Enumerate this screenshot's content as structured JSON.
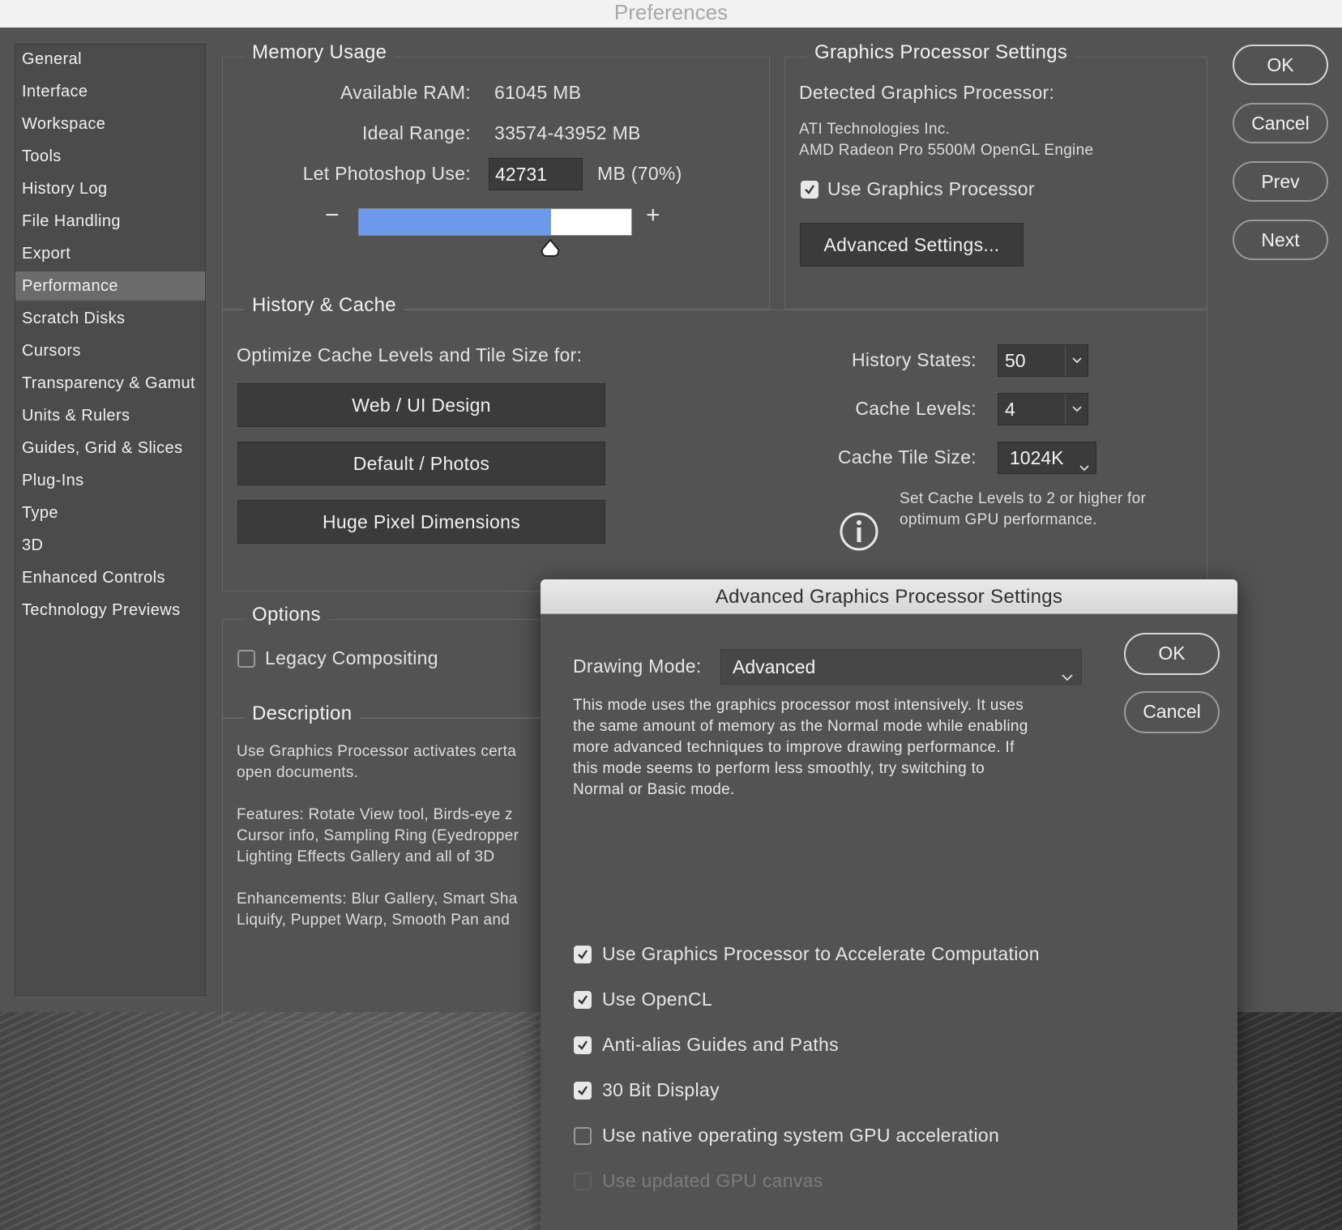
{
  "window": {
    "title": "Preferences"
  },
  "sidebar": {
    "items": [
      {
        "label": "General"
      },
      {
        "label": "Interface"
      },
      {
        "label": "Workspace"
      },
      {
        "label": "Tools"
      },
      {
        "label": "History Log"
      },
      {
        "label": "File Handling"
      },
      {
        "label": "Export"
      },
      {
        "label": "Performance"
      },
      {
        "label": "Scratch Disks"
      },
      {
        "label": "Cursors"
      },
      {
        "label": "Transparency & Gamut"
      },
      {
        "label": "Units & Rulers"
      },
      {
        "label": "Guides, Grid & Slices"
      },
      {
        "label": "Plug-Ins"
      },
      {
        "label": "Type"
      },
      {
        "label": "3D"
      },
      {
        "label": "Enhanced Controls"
      },
      {
        "label": "Technology Previews"
      }
    ],
    "selected": "Performance"
  },
  "memory": {
    "legend": "Memory Usage",
    "available_label": "Available RAM:",
    "available_value": "61045 MB",
    "ideal_label": "Ideal Range:",
    "ideal_value": "33574-43952 MB",
    "let_use_label": "Let Photoshop Use:",
    "let_use_value": "42731",
    "let_use_suffix": "MB (70%)",
    "minus": "−",
    "plus": "+",
    "slider_fraction": 0.7
  },
  "gpu": {
    "legend": "Graphics Processor Settings",
    "detected_label": "Detected Graphics Processor:",
    "vendor": "ATI Technologies Inc.",
    "model": "AMD Radeon Pro 5500M OpenGL Engine",
    "use_label": "Use Graphics Processor",
    "use_checked": true,
    "advanced_button": "Advanced Settings..."
  },
  "history_cache": {
    "legend": "History & Cache",
    "optimize_label": "Optimize Cache Levels and Tile Size for:",
    "buttons": [
      "Web / UI Design",
      "Default / Photos",
      "Huge Pixel Dimensions"
    ],
    "history_states_label": "History States:",
    "history_states_value": "50",
    "cache_levels_label": "Cache Levels:",
    "cache_levels_value": "4",
    "tile_size_label": "Cache Tile Size:",
    "tile_size_value": "1024K",
    "info_line1": "Set Cache Levels to 2 or higher for",
    "info_line2": "optimum GPU performance."
  },
  "options": {
    "legend": "Options",
    "legacy_label": "Legacy Compositing",
    "legacy_checked": false
  },
  "description": {
    "legend": "Description",
    "lines": [
      "Use Graphics Processor activates certa",
      "open documents.",
      "",
      "Features: Rotate View tool, Birds-eye z",
      "Cursor info, Sampling Ring (Eyedropper",
      "Lighting Effects Gallery and all of 3D",
      "",
      "Enhancements: Blur Gallery, Smart Sha",
      "Liquify, Puppet Warp, Smooth Pan and"
    ]
  },
  "window_buttons": {
    "ok": "OK",
    "cancel": "Cancel",
    "prev": "Prev",
    "next": "Next"
  },
  "advanced_dialog": {
    "title": "Advanced Graphics Processor Settings",
    "drawing_mode_label": "Drawing Mode:",
    "drawing_mode_value": "Advanced",
    "description_lines": [
      "This mode uses the graphics processor most intensively.  It uses",
      "the same amount of memory as the Normal mode while enabling",
      "more advanced techniques to improve drawing performance.  If",
      "this mode seems to perform less smoothly, try switching to",
      "Normal or Basic mode."
    ],
    "ok": "OK",
    "cancel": "Cancel",
    "options": [
      {
        "label": "Use Graphics Processor to Accelerate Computation",
        "checked": true,
        "enabled": true
      },
      {
        "label": "Use OpenCL",
        "checked": true,
        "enabled": true
      },
      {
        "label": "Anti-alias Guides and Paths",
        "checked": true,
        "enabled": true
      },
      {
        "label": "30 Bit Display",
        "checked": true,
        "enabled": true
      },
      {
        "label": "Use native operating system GPU acceleration",
        "checked": false,
        "enabled": true
      },
      {
        "label": "Use updated GPU canvas",
        "checked": false,
        "enabled": false
      }
    ]
  },
  "colors": {
    "slider_fill": "#6b9aec",
    "panel": "#535353",
    "selected_item": "#6b6b6b"
  }
}
